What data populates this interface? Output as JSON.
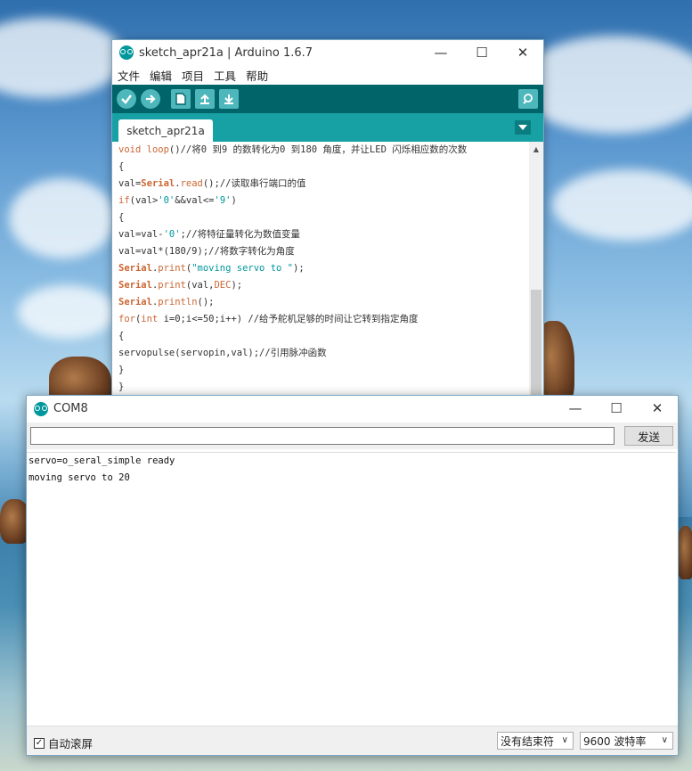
{
  "ide": {
    "title": "sketch_apr21a | Arduino 1.6.7",
    "menu": [
      "文件",
      "编辑",
      "项目",
      "工具",
      "帮助"
    ],
    "toolbar": {
      "verify_icon": "check-icon",
      "upload_icon": "arrow-right-icon",
      "new_icon": "file-icon",
      "open_icon": "upload-arrow-icon",
      "save_icon": "download-arrow-icon",
      "serial_icon": "magnifier-icon"
    },
    "tab_label": "sketch_apr21a",
    "code": [
      "void loop()//将0 到9 的数转化为0 到180 角度，并让LED 闪烁相应数的次数",
      "{",
      "val=Serial.read();//读取串行端口的值",
      "if(val>'0'&&val<='9')",
      "{",
      "val=val-'0';//将特征量转化为数值变量",
      "val=val*(180/9);//将数字转化为角度",
      "Serial.print(\"moving servo to \");",
      "Serial.print(val,DEC);",
      "Serial.println();",
      "for(int i=0;i<=50;i++) //给予舵机足够的时间让它转到指定角度",
      "{",
      "servopulse(servopin,val);//引用脉冲函数",
      "}",
      "}"
    ],
    "window_buttons": {
      "minimize": "—",
      "maximize": "☐",
      "close": "✕"
    }
  },
  "serial": {
    "title": "COM8",
    "send_input_value": "",
    "send_label": "发送",
    "output": [
      "servo=o_seral_simple ready",
      "moving servo to 20"
    ],
    "autoscroll_label": "自动滚屏",
    "autoscroll_checked": true,
    "line_ending": "没有结束符",
    "baud_rate": "9600 波特率",
    "window_buttons": {
      "minimize": "—",
      "maximize": "☐",
      "close": "✕"
    }
  },
  "colors": {
    "arduino_teal_dark": "#006468",
    "arduino_teal": "#17a1a5",
    "keyword_orange": "#cc6633",
    "string_teal": "#00979c"
  }
}
